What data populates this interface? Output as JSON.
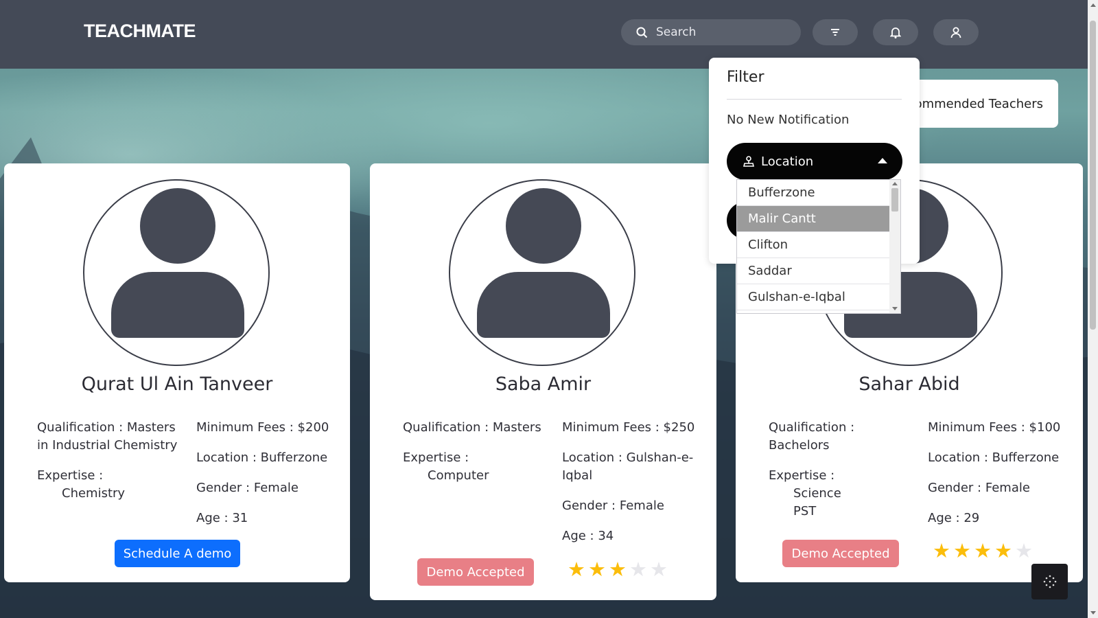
{
  "app": {
    "logo": "TEACHMATE"
  },
  "search": {
    "placeholder": "Search"
  },
  "recommended_label": "ommended Teachers",
  "filter_panel": {
    "title": "Filter",
    "notification": "No New Notification",
    "location_label": "Location",
    "options": [
      "Bufferzone",
      "Malir Cantt",
      "Clifton",
      "Saddar",
      "Gulshan-e-Iqbal"
    ],
    "highlighted_option": "Malir Cantt"
  },
  "teachers": [
    {
      "name": "Qurat Ul Ain Tanveer",
      "qualification_line1": "Qualification : Masters",
      "qualification_line2": "in Industrial Chemistry",
      "expertise_label": "Expertise :",
      "expertise": [
        "Chemistry"
      ],
      "fees": "Minimum Fees : $200",
      "location": "Location : Bufferzone",
      "gender": "Gender : Female",
      "age": "Age : 31",
      "action": "Schedule A demo"
    },
    {
      "name": "Saba Amir",
      "qualification_line1": "Qualification : Masters",
      "expertise_label": "Expertise :",
      "expertise": [
        "Computer"
      ],
      "fees": "Minimum Fees : $250",
      "location_line1": "Location : Gulshan-e-",
      "location_line2": "Iqbal",
      "gender": "Gender : Female",
      "age": "Age : 34",
      "action": "Demo Accepted",
      "rating": 3
    },
    {
      "name": "Sahar Abid",
      "qualification_line1": "Qualification :",
      "qualification_line2": "Bachelors",
      "expertise_label": "Expertise :",
      "expertise": [
        "Science",
        "PST"
      ],
      "fees": "Minimum Fees : $100",
      "location": "Location : Bufferzone",
      "gender": "Gender : Female",
      "age": "Age : 29",
      "action": "Demo Accepted",
      "rating": 4
    }
  ],
  "colors": {
    "navbar": "#444a57",
    "primary": "#0d6efd",
    "accepted": "#e87f86",
    "star": "#fbbd0b"
  }
}
